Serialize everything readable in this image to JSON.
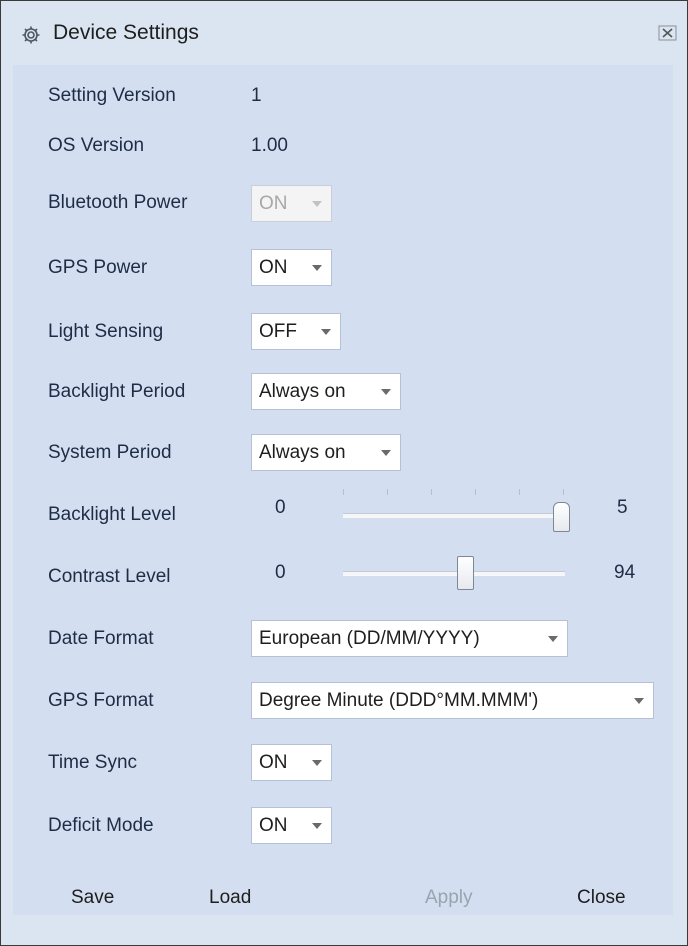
{
  "window": {
    "title": "Device Settings",
    "icon": "gear-icon",
    "close_icon": "close-icon"
  },
  "info": {
    "setting_version_label": "Setting Version",
    "setting_version_value": "1",
    "os_version_label": "OS Version",
    "os_version_value": "1.00"
  },
  "settings": {
    "bluetooth_power": {
      "label": "Bluetooth Power",
      "value": "ON",
      "disabled": true
    },
    "gps_power": {
      "label": "GPS Power",
      "value": "ON"
    },
    "light_sensing": {
      "label": "Light Sensing",
      "value": "OFF"
    },
    "backlight_period": {
      "label": "Backlight Period",
      "value": "Always on"
    },
    "system_period": {
      "label": "System Period",
      "value": "Always on"
    },
    "backlight_level": {
      "label": "Backlight Level",
      "min": "0",
      "value": "5",
      "max_value": 5,
      "position_fraction": 1.0
    },
    "contrast_level": {
      "label": "Contrast Level",
      "min": "0",
      "value": "94",
      "position_fraction": 0.55
    },
    "date_format": {
      "label": "Date Format",
      "value": "European (DD/MM/YYYY)"
    },
    "gps_format": {
      "label": "GPS Format",
      "value": "Degree Minute (DDD°MM.MMM')"
    },
    "time_sync": {
      "label": "Time Sync",
      "value": "ON"
    },
    "deficit_mode": {
      "label": "Deficit Mode",
      "value": "ON"
    }
  },
  "buttons": {
    "save": "Save",
    "load": "Load",
    "apply": "Apply",
    "close": "Close"
  },
  "colors": {
    "window_bg": "#dbe5f1",
    "panel_bg": "#d3dff0",
    "label_text": "#1e2c46",
    "disabled_text": "#9aa3ae"
  }
}
